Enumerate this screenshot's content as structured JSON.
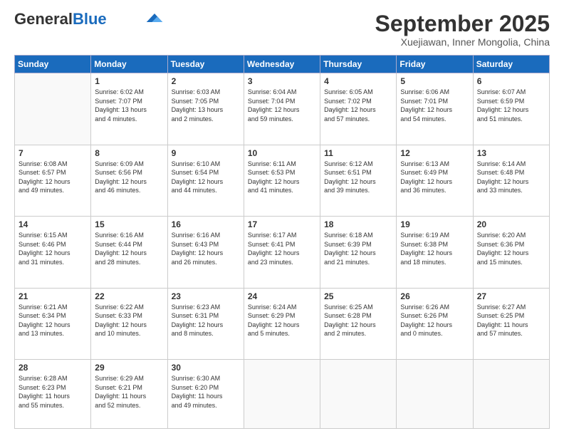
{
  "header": {
    "logo_general": "General",
    "logo_blue": "Blue",
    "month": "September 2025",
    "location": "Xuejiawan, Inner Mongolia, China"
  },
  "weekdays": [
    "Sunday",
    "Monday",
    "Tuesday",
    "Wednesday",
    "Thursday",
    "Friday",
    "Saturday"
  ],
  "weeks": [
    [
      {
        "day": "",
        "info": ""
      },
      {
        "day": "1",
        "info": "Sunrise: 6:02 AM\nSunset: 7:07 PM\nDaylight: 13 hours\nand 4 minutes."
      },
      {
        "day": "2",
        "info": "Sunrise: 6:03 AM\nSunset: 7:05 PM\nDaylight: 13 hours\nand 2 minutes."
      },
      {
        "day": "3",
        "info": "Sunrise: 6:04 AM\nSunset: 7:04 PM\nDaylight: 12 hours\nand 59 minutes."
      },
      {
        "day": "4",
        "info": "Sunrise: 6:05 AM\nSunset: 7:02 PM\nDaylight: 12 hours\nand 57 minutes."
      },
      {
        "day": "5",
        "info": "Sunrise: 6:06 AM\nSunset: 7:01 PM\nDaylight: 12 hours\nand 54 minutes."
      },
      {
        "day": "6",
        "info": "Sunrise: 6:07 AM\nSunset: 6:59 PM\nDaylight: 12 hours\nand 51 minutes."
      }
    ],
    [
      {
        "day": "7",
        "info": "Sunrise: 6:08 AM\nSunset: 6:57 PM\nDaylight: 12 hours\nand 49 minutes."
      },
      {
        "day": "8",
        "info": "Sunrise: 6:09 AM\nSunset: 6:56 PM\nDaylight: 12 hours\nand 46 minutes."
      },
      {
        "day": "9",
        "info": "Sunrise: 6:10 AM\nSunset: 6:54 PM\nDaylight: 12 hours\nand 44 minutes."
      },
      {
        "day": "10",
        "info": "Sunrise: 6:11 AM\nSunset: 6:53 PM\nDaylight: 12 hours\nand 41 minutes."
      },
      {
        "day": "11",
        "info": "Sunrise: 6:12 AM\nSunset: 6:51 PM\nDaylight: 12 hours\nand 39 minutes."
      },
      {
        "day": "12",
        "info": "Sunrise: 6:13 AM\nSunset: 6:49 PM\nDaylight: 12 hours\nand 36 minutes."
      },
      {
        "day": "13",
        "info": "Sunrise: 6:14 AM\nSunset: 6:48 PM\nDaylight: 12 hours\nand 33 minutes."
      }
    ],
    [
      {
        "day": "14",
        "info": "Sunrise: 6:15 AM\nSunset: 6:46 PM\nDaylight: 12 hours\nand 31 minutes."
      },
      {
        "day": "15",
        "info": "Sunrise: 6:16 AM\nSunset: 6:44 PM\nDaylight: 12 hours\nand 28 minutes."
      },
      {
        "day": "16",
        "info": "Sunrise: 6:16 AM\nSunset: 6:43 PM\nDaylight: 12 hours\nand 26 minutes."
      },
      {
        "day": "17",
        "info": "Sunrise: 6:17 AM\nSunset: 6:41 PM\nDaylight: 12 hours\nand 23 minutes."
      },
      {
        "day": "18",
        "info": "Sunrise: 6:18 AM\nSunset: 6:39 PM\nDaylight: 12 hours\nand 21 minutes."
      },
      {
        "day": "19",
        "info": "Sunrise: 6:19 AM\nSunset: 6:38 PM\nDaylight: 12 hours\nand 18 minutes."
      },
      {
        "day": "20",
        "info": "Sunrise: 6:20 AM\nSunset: 6:36 PM\nDaylight: 12 hours\nand 15 minutes."
      }
    ],
    [
      {
        "day": "21",
        "info": "Sunrise: 6:21 AM\nSunset: 6:34 PM\nDaylight: 12 hours\nand 13 minutes."
      },
      {
        "day": "22",
        "info": "Sunrise: 6:22 AM\nSunset: 6:33 PM\nDaylight: 12 hours\nand 10 minutes."
      },
      {
        "day": "23",
        "info": "Sunrise: 6:23 AM\nSunset: 6:31 PM\nDaylight: 12 hours\nand 8 minutes."
      },
      {
        "day": "24",
        "info": "Sunrise: 6:24 AM\nSunset: 6:29 PM\nDaylight: 12 hours\nand 5 minutes."
      },
      {
        "day": "25",
        "info": "Sunrise: 6:25 AM\nSunset: 6:28 PM\nDaylight: 12 hours\nand 2 minutes."
      },
      {
        "day": "26",
        "info": "Sunrise: 6:26 AM\nSunset: 6:26 PM\nDaylight: 12 hours\nand 0 minutes."
      },
      {
        "day": "27",
        "info": "Sunrise: 6:27 AM\nSunset: 6:25 PM\nDaylight: 11 hours\nand 57 minutes."
      }
    ],
    [
      {
        "day": "28",
        "info": "Sunrise: 6:28 AM\nSunset: 6:23 PM\nDaylight: 11 hours\nand 55 minutes."
      },
      {
        "day": "29",
        "info": "Sunrise: 6:29 AM\nSunset: 6:21 PM\nDaylight: 11 hours\nand 52 minutes."
      },
      {
        "day": "30",
        "info": "Sunrise: 6:30 AM\nSunset: 6:20 PM\nDaylight: 11 hours\nand 49 minutes."
      },
      {
        "day": "",
        "info": ""
      },
      {
        "day": "",
        "info": ""
      },
      {
        "day": "",
        "info": ""
      },
      {
        "day": "",
        "info": ""
      }
    ]
  ]
}
